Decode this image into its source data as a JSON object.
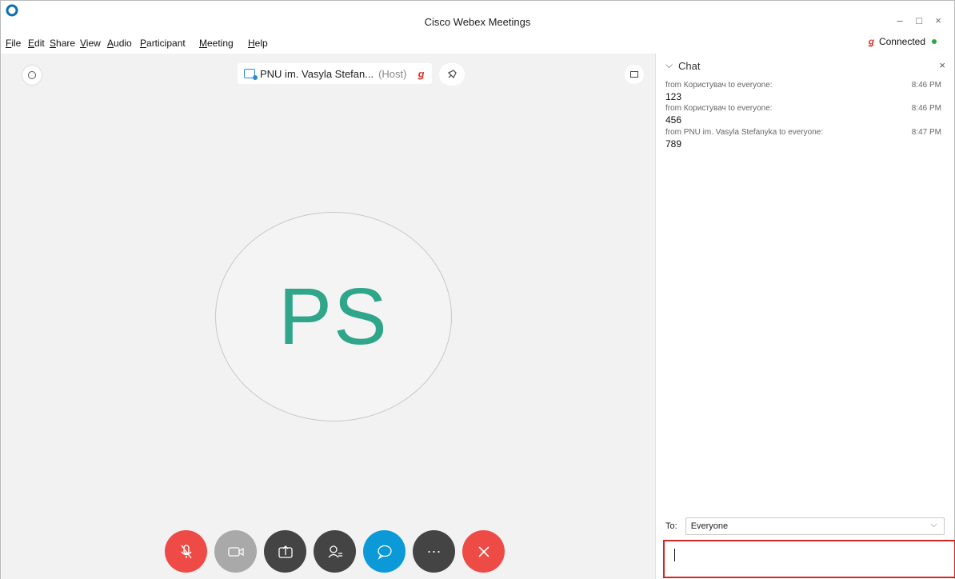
{
  "window": {
    "title": "Cisco Webex Meetings",
    "minimize": "–",
    "maximize": "□",
    "close": "×"
  },
  "menu": [
    "File",
    "Edit",
    "Share",
    "View",
    "Audio",
    "Participant",
    "Meeting",
    "Help"
  ],
  "connection": {
    "status": "Connected"
  },
  "stage": {
    "host_name": "PNU im. Vasyla Stefan...",
    "host_role": "(Host)",
    "avatar_initials": "PS"
  },
  "controls": {
    "more_label": "···"
  },
  "chat": {
    "title": "Chat",
    "messages": [
      {
        "from": "from Користувач to everyone:",
        "time": "8:46 PM",
        "text": "123"
      },
      {
        "from": "from Користувач to everyone:",
        "time": "8:46 PM",
        "text": "456"
      },
      {
        "from": "from PNU im. Vasyla Stefanyka to everyone:",
        "time": "8:47 PM",
        "text": "789"
      }
    ],
    "to_label": "To:",
    "to_value": "Everyone"
  },
  "colors": {
    "accent": "#0b9ad7",
    "danger": "#ef4b46",
    "avatar_text": "#2fa58a"
  }
}
